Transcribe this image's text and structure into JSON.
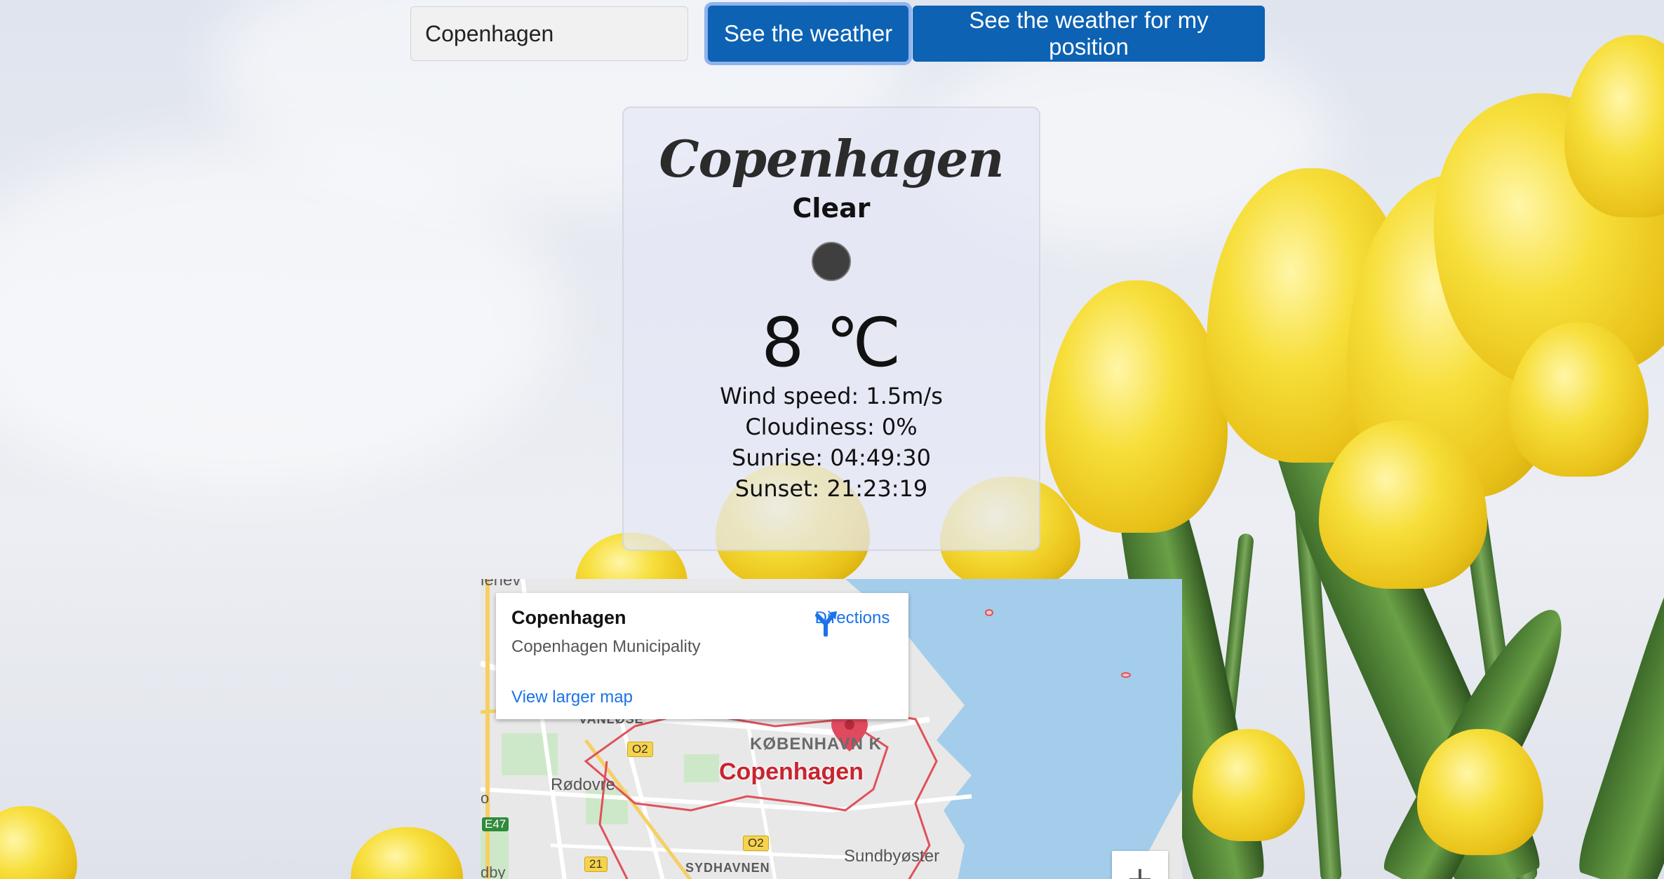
{
  "search": {
    "value": "Copenhagen",
    "weather_button": "See the weather",
    "position_button": "See the weather for my position"
  },
  "weather": {
    "city": "Copenhagen",
    "condition": "Clear",
    "temperature": "8 ℃",
    "wind": "Wind speed: 1.5m/s",
    "cloudiness": "Cloudiness: 0%",
    "sunrise": "Sunrise: 04:49:30",
    "sunset": "Sunset: 21:23:19"
  },
  "map": {
    "info_title": "Copenhagen",
    "info_subtitle": "Copenhagen Municipality",
    "directions": "Directions",
    "view_larger": "View larger map",
    "zoom_in": "+",
    "labels": {
      "koebenhavn": "KØBENHAVN K",
      "copenhagen": "Copenhagen",
      "rodovre": "Rødovre",
      "sundbyoster": "Sundbyøster",
      "sydhavnen": "SYDHAVNEN",
      "vanloese": "VANLØSE",
      "road_o2a": "O2",
      "road_o2b": "O2",
      "road_21": "21",
      "road_e47": "E47",
      "edge_top": "lenev",
      "edge_bottom": "dby",
      "edge_left": "o"
    }
  },
  "colors": {
    "button_blue": "#0d62b3",
    "link_blue": "#1a73e8",
    "water": "#a3cdeb",
    "marker_red": "#e04a5f"
  }
}
